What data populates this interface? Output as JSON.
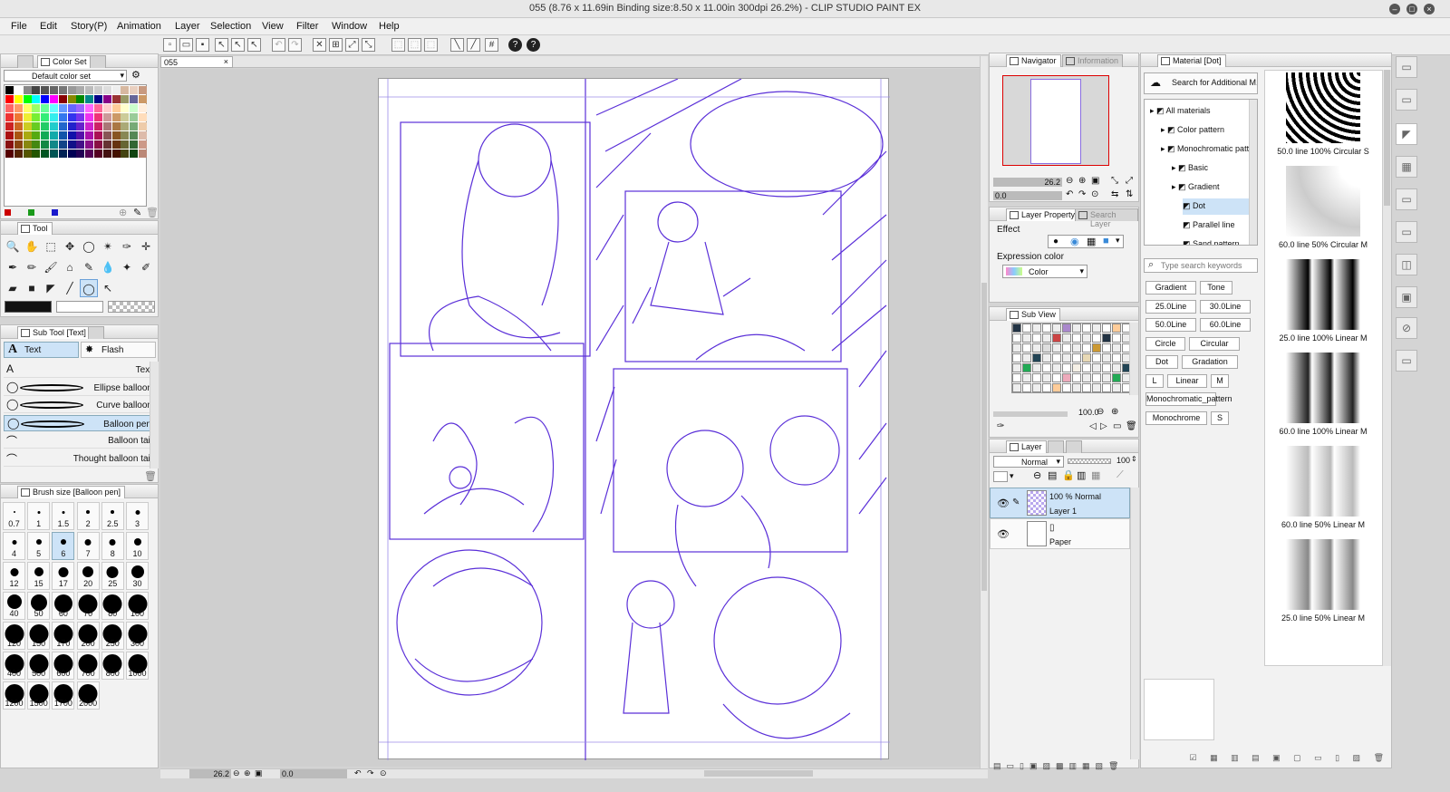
{
  "window": {
    "title": "055 (8.76 x 11.69in Binding size:8.50 x 11.00in 300dpi 26.2%) - CLIP STUDIO PAINT EX"
  },
  "menu": [
    "File",
    "Edit",
    "Story(P)",
    "Animation",
    "Layer",
    "Selection",
    "View",
    "Filter",
    "Window",
    "Help"
  ],
  "canvas": {
    "tab": "055",
    "zoom": "26.2",
    "angle": "0.0"
  },
  "color_set": {
    "tab": "Color Set",
    "preset": "Default color set"
  },
  "tool": {
    "tab": "Tool"
  },
  "sub_tool": {
    "tab": "Sub Tool [Text]",
    "group_text": "Text",
    "group_flash": "Flash",
    "items": [
      "Text",
      "Ellipse balloon",
      "Curve balloon",
      "Balloon pen",
      "Balloon tail",
      "Thought balloon tail"
    ],
    "selected": "Balloon pen"
  },
  "brush_size": {
    "tab": "Brush size [Balloon pen]",
    "selected": "6",
    "sizes": [
      "0.7",
      "1",
      "1.5",
      "2",
      "2.5",
      "3",
      "4",
      "5",
      "6",
      "7",
      "8",
      "10",
      "12",
      "15",
      "17",
      "20",
      "25",
      "30",
      "40",
      "50",
      "60",
      "70",
      "80",
      "100",
      "120",
      "150",
      "170",
      "200",
      "250",
      "300",
      "400",
      "500",
      "600",
      "700",
      "800",
      "1000",
      "1200",
      "1500",
      "1700",
      "2000"
    ]
  },
  "navigator": {
    "tab": "Navigator",
    "tab2": "Information",
    "zoom": "26.2",
    "angle": "0.0"
  },
  "layer_property": {
    "tab": "Layer Property",
    "tab2": "Search Layer",
    "effect_label": "Effect",
    "expression_label": "Expression color",
    "expression_value": "Color"
  },
  "sub_view": {
    "tab": "Sub View",
    "opacity": "100.0"
  },
  "layer": {
    "tab": "Layer",
    "blend": "Normal",
    "opacity": "100",
    "layers": [
      {
        "info": "100 % Normal",
        "name": "Layer 1",
        "selected": true
      },
      {
        "info": "",
        "name": "Paper",
        "selected": false
      }
    ]
  },
  "material": {
    "tab": "Material [Dot]",
    "search_button": "Search for Additional M...",
    "tree": [
      {
        "label": "All materials",
        "indent": 0
      },
      {
        "label": "Color pattern",
        "indent": 1
      },
      {
        "label": "Monochromatic patte",
        "indent": 1
      },
      {
        "label": "Basic",
        "indent": 2
      },
      {
        "label": "Gradient",
        "indent": 2
      },
      {
        "label": "Dot",
        "indent": 3,
        "selected": true
      },
      {
        "label": "Parallel line",
        "indent": 3
      },
      {
        "label": "Sand pattern",
        "indent": 3
      }
    ],
    "keyword_placeholder": "Type search keywords",
    "tags": [
      [
        "Gradient",
        "Tone"
      ],
      [
        "25.0Line",
        "30.0Line"
      ],
      [
        "50.0Line",
        "60.0Line"
      ],
      [
        "Circle",
        "Circular"
      ],
      [
        "Dot",
        "Gradation"
      ],
      [
        "L",
        "Linear",
        "M"
      ],
      [
        "Monochromatic_pattern"
      ],
      [
        "Monochrome",
        "S"
      ]
    ],
    "items": [
      "50.0 line 100% Circular S",
      "60.0 line 50% Circular M",
      "25.0 line 100% Linear M",
      "60.0 line 100% Linear M",
      "60.0 line 50% Linear M",
      "25.0 line 50% Linear M"
    ]
  }
}
